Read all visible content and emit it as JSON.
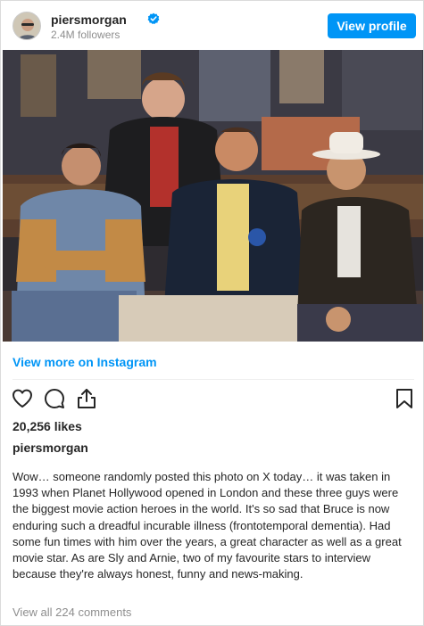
{
  "post": {
    "username": "piersmorgan",
    "followers": "2.4M followers",
    "view_profile_label": "View profile",
    "view_more_label": "View more on Instagram",
    "likes": "20,256 likes",
    "caption_username": "piersmorgan",
    "caption": "Wow… someone randomly posted this photo on X today… it was taken in 1993 when Planet Hollywood opened in London and these three guys were the biggest movie action heroes in the world. It's so sad that Bruce is now enduring such a dreadful incurable illness (frontotemporal dementia). Had some fun times with him over the years, a great character as well as a great movie star. As are Sly and Arnie, two of my favourite stars to interview because they're always honest, funny and news-making.",
    "comments_link": "View all 224 comments"
  },
  "icons": {
    "verified": "verified-badge-icon",
    "like": "heart-icon",
    "comment": "comment-icon",
    "share": "share-icon",
    "save": "bookmark-icon"
  },
  "colors": {
    "accent": "#0095f6",
    "text": "#262626",
    "muted": "#8e8e8e"
  }
}
